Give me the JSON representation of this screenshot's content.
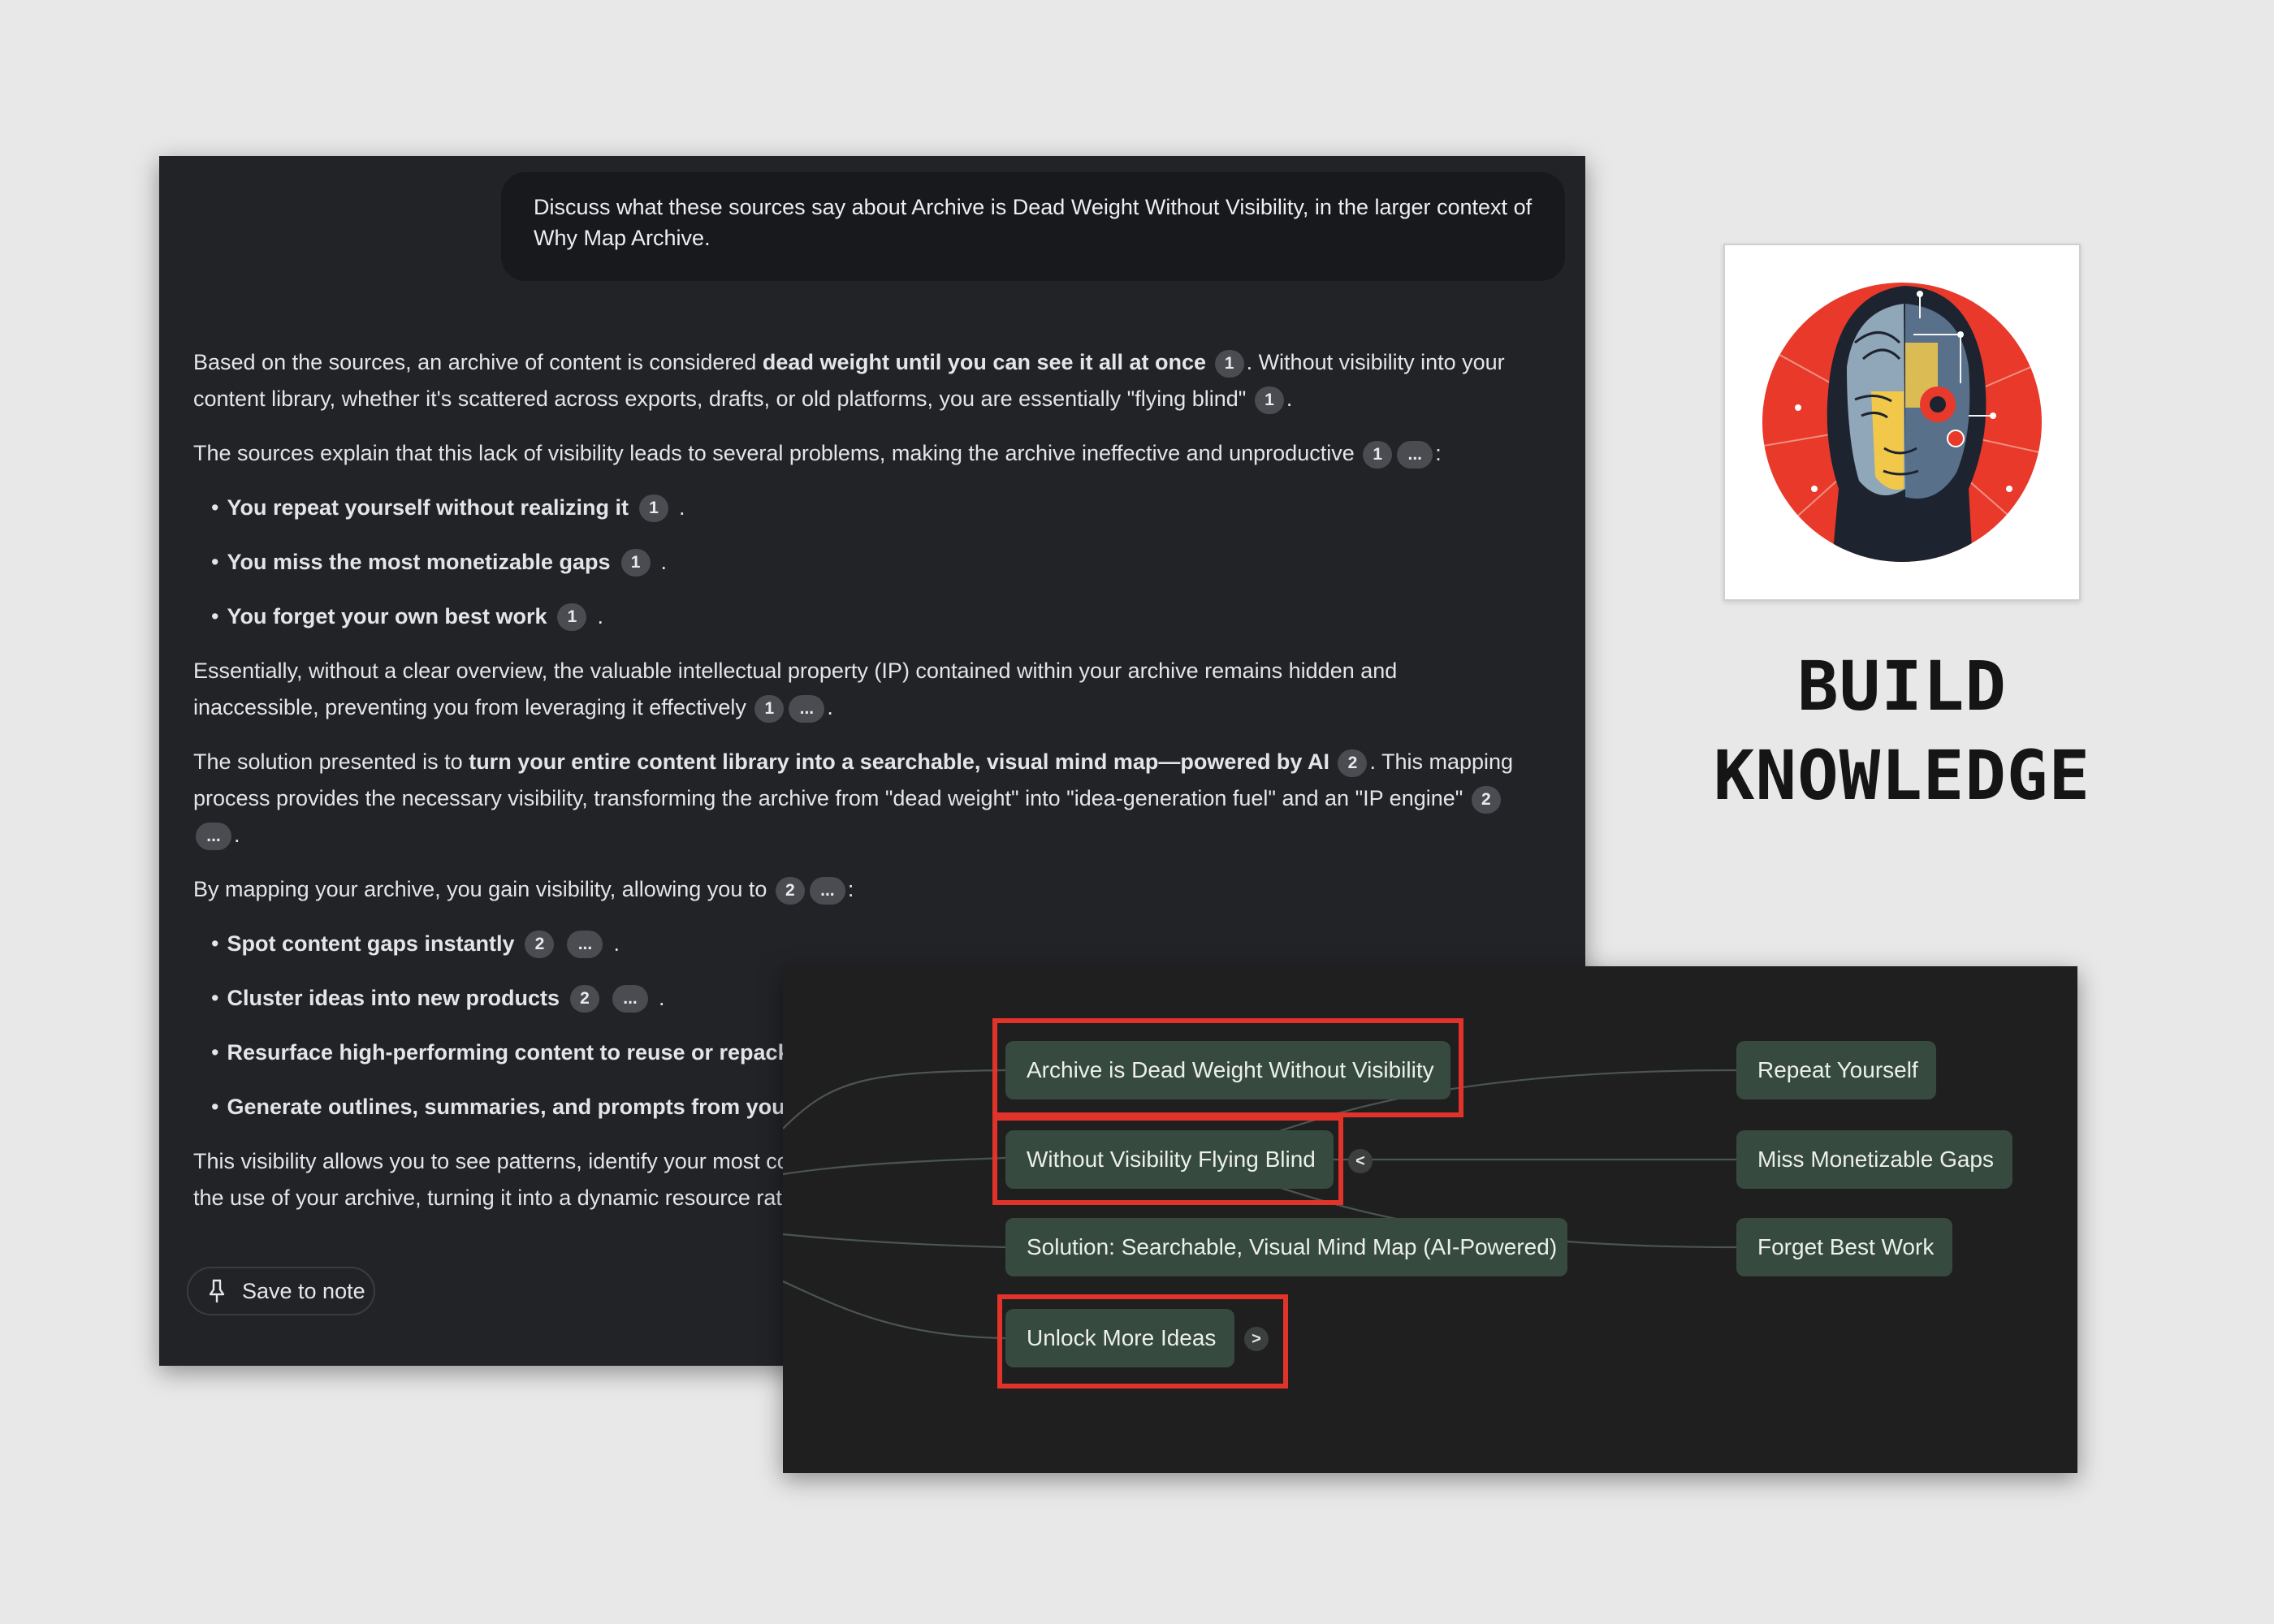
{
  "chat": {
    "prompt": "Discuss what these sources say about Archive is Dead Weight Without Visibility, in the larger context of Why Map Archive.",
    "p1": {
      "a": "Based on the sources, an archive of content is considered ",
      "b": "dead weight until you can see it all at once",
      "c": ". Without visibility into your content library, whether it's scattered across exports, drafts, or old platforms, you are essentially \"flying blind\"",
      "d": "."
    },
    "p2": {
      "a": "The sources explain that this lack of visibility leads to several problems, making the archive ineffective and unproductive",
      "b": ":"
    },
    "bullets_a": [
      "You repeat yourself without realizing it",
      "You miss the most monetizable gaps",
      "You forget your own best work"
    ],
    "p3": {
      "a": "Essentially, without a clear overview, the valuable intellectual property (IP) contained within your archive remains hidden and inaccessible, preventing you from leveraging it effectively",
      "b": "."
    },
    "p4": {
      "a": "The solution presented is to ",
      "b": "turn your entire content library into a searchable, visual mind map—powered by AI",
      "c": ". This mapping process provides the necessary visibility, transforming the archive from \"dead weight\" into \"idea-generation fuel\" and an \"IP engine\"",
      "d": "."
    },
    "p5": {
      "a": "By mapping your archive, you gain visibility, allowing you to",
      "b": ":"
    },
    "bullets_b": [
      "Spot content gaps instantly",
      "Cluster ideas into new products",
      "Resurface high-performing content to reuse or repacka",
      "Generate outlines, summaries, and prompts from your c"
    ],
    "p6": {
      "a": "This visibility allows you to see patterns, identify your most co",
      "b": "the use of your archive, turning it into a dynamic resource rat"
    },
    "cite_1": "1",
    "cite_2": "2",
    "cite_more": "...",
    "bullet_dot": "•",
    "save_label": "Save to note"
  },
  "build": {
    "line1": "BUILD",
    "line2": "KNOWLEDGE"
  },
  "mindmap": {
    "nodes": [
      "Archive is Dead Weight Without Visibility",
      "Without Visibility Flying Blind",
      "Solution: Searchable, Visual Mind Map (AI-Powered)",
      "Unlock More Ideas"
    ],
    "children": [
      "Repeat Yourself",
      "Miss Monetizable Gaps",
      "Forget Best Work"
    ],
    "collapse_glyph": "<",
    "expand_glyph": ">",
    "node_color": "#364a3f",
    "highlight_color": "#e2332b"
  },
  "colors": {
    "page_bg": "#e8e8e8",
    "panel_bg": "#222327",
    "citation_bg": "#4a4c52"
  },
  "icons": {
    "save": "pin-icon",
    "portrait": "ai-face-portrait-icon"
  }
}
